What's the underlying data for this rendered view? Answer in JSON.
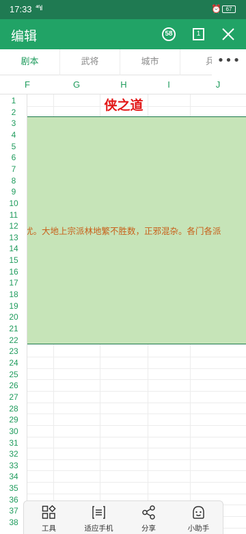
{
  "status_bar": {
    "time": "17:33",
    "network": "⁴⁶ıl",
    "battery": "67"
  },
  "app_bar": {
    "title": "编辑",
    "count_badge": "58",
    "page_indicator": "1"
  },
  "tabs": [
    {
      "label": "剧本",
      "active": true
    },
    {
      "label": "武将",
      "active": false
    },
    {
      "label": "城市",
      "active": false
    },
    {
      "label": "兵",
      "active": false
    }
  ],
  "more_label": "•••",
  "columns": [
    "F",
    "G",
    "H",
    "I",
    "J"
  ],
  "rows": [
    "1",
    "2",
    "3",
    "4",
    "5",
    "6",
    "7",
    "8",
    "9",
    "10",
    "11",
    "12",
    "13",
    "14",
    "15",
    "16",
    "17",
    "18",
    "19",
    "20",
    "21",
    "22",
    "23",
    "24",
    "25",
    "26",
    "27",
    "28",
    "29",
    "30",
    "31",
    "32",
    "33",
    "34",
    "35",
    "36",
    "37",
    "38"
  ],
  "sheet": {
    "title": "侠之道",
    "body_text": "忧。大地上宗派林地繁不胜数，正邪混杂。各门各派"
  },
  "toolbar": [
    {
      "label": "工具",
      "icon": "tools-icon"
    },
    {
      "label": "适应手机",
      "icon": "fit-phone-icon"
    },
    {
      "label": "分享",
      "icon": "share-icon"
    },
    {
      "label": "小助手",
      "icon": "assistant-icon"
    }
  ],
  "colors": {
    "status_bar": "#1f7a52",
    "app_bar": "#21a366",
    "accent_green": "#1e9b5c",
    "title_red": "#e21818",
    "block_fill": "#c6e4b8",
    "block_text": "#c8601a"
  }
}
